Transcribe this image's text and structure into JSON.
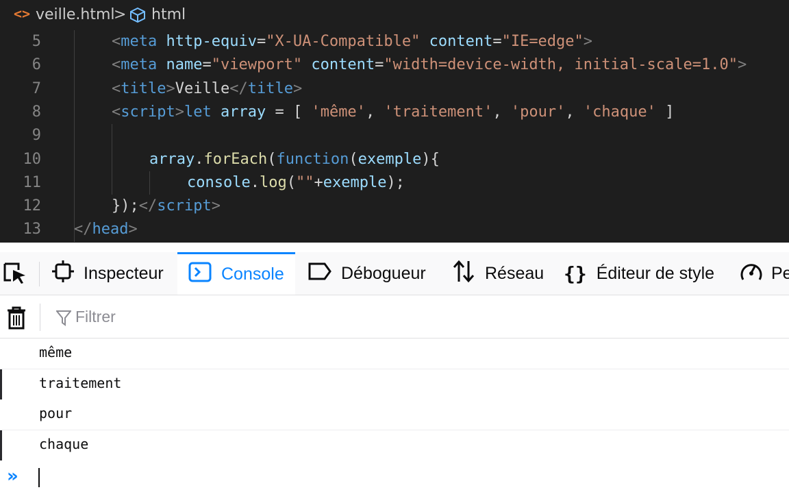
{
  "editor": {
    "breadcrumb": {
      "file_icon": "<>",
      "file": "veille.html",
      "separator": ">",
      "symbol": "html"
    },
    "lines": [
      {
        "num": "5",
        "tokens": [
          [
            "punct",
            "<"
          ],
          [
            "tag",
            "meta"
          ],
          [
            "txt",
            " "
          ],
          [
            "attr",
            "http-equiv"
          ],
          [
            "op",
            "="
          ],
          [
            "str",
            "\"X-UA-Compatible\""
          ],
          [
            "txt",
            " "
          ],
          [
            "attr",
            "content"
          ],
          [
            "op",
            "="
          ],
          [
            "str",
            "\"IE=edge\""
          ],
          [
            "punct",
            ">"
          ]
        ],
        "indent": 2
      },
      {
        "num": "6",
        "tokens": [
          [
            "punct",
            "<"
          ],
          [
            "tag",
            "meta"
          ],
          [
            "txt",
            " "
          ],
          [
            "attr",
            "name"
          ],
          [
            "op",
            "="
          ],
          [
            "str",
            "\"viewport\""
          ],
          [
            "txt",
            " "
          ],
          [
            "attr",
            "content"
          ],
          [
            "op",
            "="
          ],
          [
            "str",
            "\"width=device-width, initial-scale=1.0\""
          ],
          [
            "punct",
            ">"
          ]
        ],
        "indent": 2
      },
      {
        "num": "7",
        "tokens": [
          [
            "punct",
            "<"
          ],
          [
            "tag",
            "title"
          ],
          [
            "punct",
            ">"
          ],
          [
            "txt",
            "Veille"
          ],
          [
            "punct",
            "</"
          ],
          [
            "tag",
            "title"
          ],
          [
            "punct",
            ">"
          ]
        ],
        "indent": 2
      },
      {
        "num": "8",
        "tokens": [
          [
            "punct",
            "<"
          ],
          [
            "tag",
            "script"
          ],
          [
            "punct",
            ">"
          ],
          [
            "kw",
            "let"
          ],
          [
            "txt",
            " "
          ],
          [
            "var",
            "array"
          ],
          [
            "op",
            " = [ "
          ],
          [
            "str",
            "'même'"
          ],
          [
            "op",
            ", "
          ],
          [
            "str",
            "'traitement'"
          ],
          [
            "op",
            ", "
          ],
          [
            "str",
            "'pour'"
          ],
          [
            "op",
            ", "
          ],
          [
            "str",
            "'chaque'"
          ],
          [
            "op",
            " ]"
          ]
        ],
        "indent": 2
      },
      {
        "num": "9",
        "tokens": [],
        "indent": 2
      },
      {
        "num": "10",
        "tokens": [
          [
            "var",
            "array"
          ],
          [
            "op",
            "."
          ],
          [
            "fn",
            "forEach"
          ],
          [
            "op",
            "("
          ],
          [
            "kw",
            "function"
          ],
          [
            "op",
            "("
          ],
          [
            "var",
            "exemple"
          ],
          [
            "op",
            "){"
          ]
        ],
        "indent": 3
      },
      {
        "num": "11",
        "tokens": [
          [
            "var",
            "console"
          ],
          [
            "op",
            "."
          ],
          [
            "fn",
            "log"
          ],
          [
            "op",
            "("
          ],
          [
            "str",
            "\"\""
          ],
          [
            "op",
            "+"
          ],
          [
            "var",
            "exemple"
          ],
          [
            "op",
            ");"
          ]
        ],
        "indent": 4
      },
      {
        "num": "12",
        "tokens": [
          [
            "op",
            "});"
          ],
          [
            "punct",
            "</"
          ],
          [
            "tag",
            "script"
          ],
          [
            "punct",
            ">"
          ]
        ],
        "indent": 2
      },
      {
        "num": "13",
        "tokens": [
          [
            "punct",
            "</"
          ],
          [
            "tag",
            "head"
          ],
          [
            "punct",
            ">"
          ]
        ],
        "indent": 1
      }
    ]
  },
  "devtools": {
    "tabs": [
      {
        "label": "Inspecteur",
        "icon": "inspector-icon",
        "active": false
      },
      {
        "label": "Console",
        "icon": "console-icon",
        "active": true
      },
      {
        "label": "Débogueur",
        "icon": "debugger-icon",
        "active": false
      },
      {
        "label": "Réseau",
        "icon": "network-icon",
        "active": false
      },
      {
        "label": "Éditeur de style",
        "icon": "style-editor-icon",
        "active": false
      },
      {
        "label": "Pe",
        "icon": "performance-icon",
        "active": false
      }
    ],
    "filter": {
      "placeholder": "Filtrer",
      "value": ""
    },
    "logs": [
      "même",
      "traitement",
      "pour",
      "chaque"
    ],
    "prompt_symbol": "»"
  },
  "colors": {
    "accent": "#0a84ff",
    "editor_bg": "#1e1e1e",
    "string": "#ce9178",
    "tag": "#569cd6",
    "attribute": "#9cdcfe"
  }
}
